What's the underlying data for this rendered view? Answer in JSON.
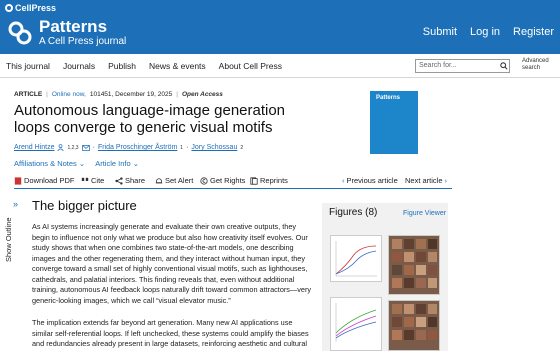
{
  "brand": {
    "publisher": "CellPress",
    "journal": "Patterns",
    "subtitle": "A Cell Press journal"
  },
  "topnav": [
    "Submit",
    "Log in",
    "Register"
  ],
  "subnav": [
    "This journal",
    "Journals",
    "Publish",
    "News & events",
    "About Cell Press"
  ],
  "search": {
    "placeholder": "Search for...",
    "advanced": "Advanced search"
  },
  "article": {
    "type": "ARTICLE",
    "online": "Online now,",
    "id_date": "101451, December 19, 2025",
    "access": "Open Access",
    "title": "Autonomous language-image generation loops converge to generic visual motifs",
    "authors": [
      {
        "name": "Arend Hintze",
        "sup": "1,2,3"
      },
      {
        "name": "Frida Proschinger Åström",
        "sup": "1"
      },
      {
        "name": "Jory Schossau",
        "sup": "2"
      }
    ],
    "author_sep": "·",
    "links": [
      "Affiliations & Notes",
      "Article Info"
    ]
  },
  "cover": {
    "label": "Patterns"
  },
  "toolbar": {
    "download": "Download PDF",
    "cite": "Cite",
    "share": "Share",
    "alert": "Set Alert",
    "rights": "Get Rights",
    "reprints": "Reprints",
    "prev": "Previous article",
    "next": "Next article"
  },
  "outline": {
    "label": "Show Outline"
  },
  "section": {
    "title": "The bigger picture",
    "p1": "As AI systems increasingly generate and evaluate their own creative outputs, they begin to influence not only what we produce but also how creativity itself evolves. Our study shows that when one combines two state-of-the-art models, one describing images and the other regenerating them, and they interact without human input, they converge toward a small set of highly conventional visual motifs, such as lighthouses, cathedrals, and palatial interiors. This finding reveals that, even without additional training, autonomous AI feedback loops naturally drift toward common attractors—very generic-looking images, which we call “visual elevator music.”",
    "p2": "The implication extends far beyond art generation. Many new AI applications use similar self-referential loops. If left unchecked, these systems could amplify the biases and redundancies already present in large datasets, reinforcing aesthetic and cultural"
  },
  "figures": {
    "title": "Figures (8)",
    "viewer": "Figure Viewer"
  },
  "colors": {
    "brand_blue": "#1d6fb8",
    "cover_blue": "#1d85c9"
  }
}
